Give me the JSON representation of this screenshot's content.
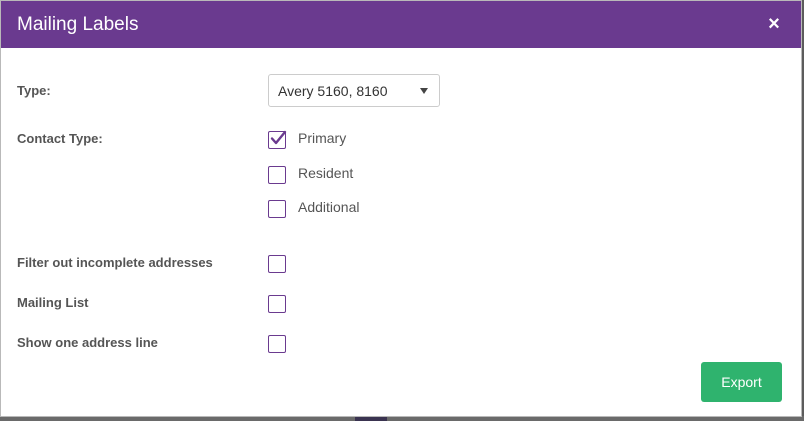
{
  "modal": {
    "title": "Mailing Labels",
    "close_glyph": "×",
    "close_icon": "close-icon"
  },
  "form": {
    "type": {
      "label": "Type:",
      "selected": "Avery 5160, 8160",
      "caret_icon": "caret-down-icon"
    },
    "contact_type": {
      "label": "Contact Type:",
      "options": [
        {
          "label": "Primary",
          "checked": true
        },
        {
          "label": "Resident",
          "checked": false
        },
        {
          "label": "Additional",
          "checked": false
        }
      ]
    },
    "filter_incomplete": {
      "label": "Filter out incomplete addresses",
      "checked": false
    },
    "mailing_list": {
      "label": "Mailing List",
      "checked": false
    },
    "one_address_line": {
      "label": "Show one address line",
      "checked": false
    }
  },
  "footer": {
    "export_label": "Export"
  },
  "colors": {
    "header": "#6a3a8f",
    "checkbox_border": "#6a3a8f",
    "export_button": "#2fb36e"
  }
}
